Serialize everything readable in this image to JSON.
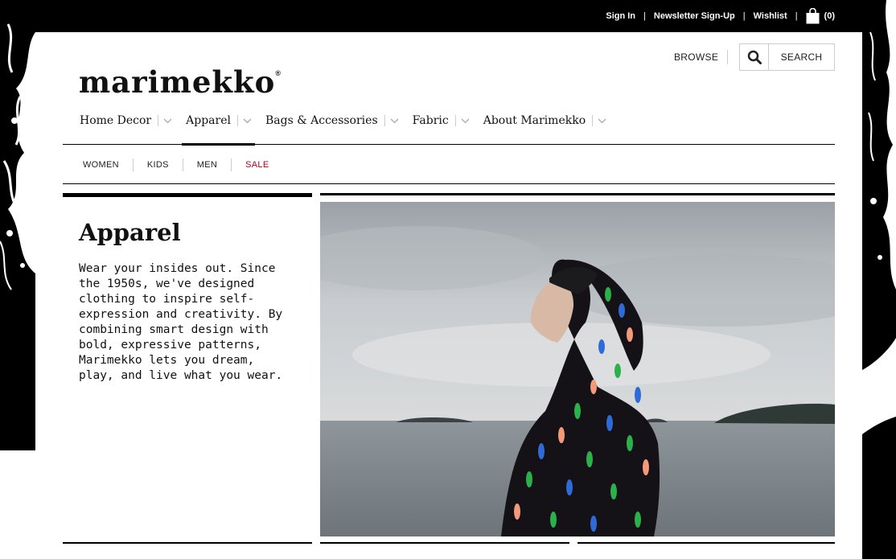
{
  "topbar": {
    "sign_in": "Sign In",
    "newsletter": "Newsletter Sign-Up",
    "wishlist": "Wishlist",
    "cart_count": "(0)",
    "sep": "|"
  },
  "brand": {
    "logo_text": "marimekko",
    "reg_mark": "®"
  },
  "header": {
    "browse_label": "BROWSE",
    "search_label": "SEARCH"
  },
  "nav": {
    "items": [
      {
        "label": "Home Decor"
      },
      {
        "label": "Apparel"
      },
      {
        "label": "Bags & Accessories"
      },
      {
        "label": "Fabric"
      },
      {
        "label": "About Marimekko"
      }
    ],
    "active": "Apparel"
  },
  "subnav": {
    "items": [
      {
        "label": "WOMEN"
      },
      {
        "label": "KIDS"
      },
      {
        "label": "MEN"
      },
      {
        "label": "SALE"
      }
    ]
  },
  "panel": {
    "title": "Apparel",
    "body": "Wear your insides out. Since the 1950s, we've designed clothing to inspire self-expression and creativity. By combining smart design with bold, expressive patterns, Marimekko lets you dream, play, and live what you wear."
  },
  "colors": {
    "sale": "#b3001b",
    "topbar": "#000000"
  },
  "icons": {
    "search": "magnifier-icon",
    "bag": "shopping-bag-icon",
    "chevron": "chevron-down-icon"
  }
}
